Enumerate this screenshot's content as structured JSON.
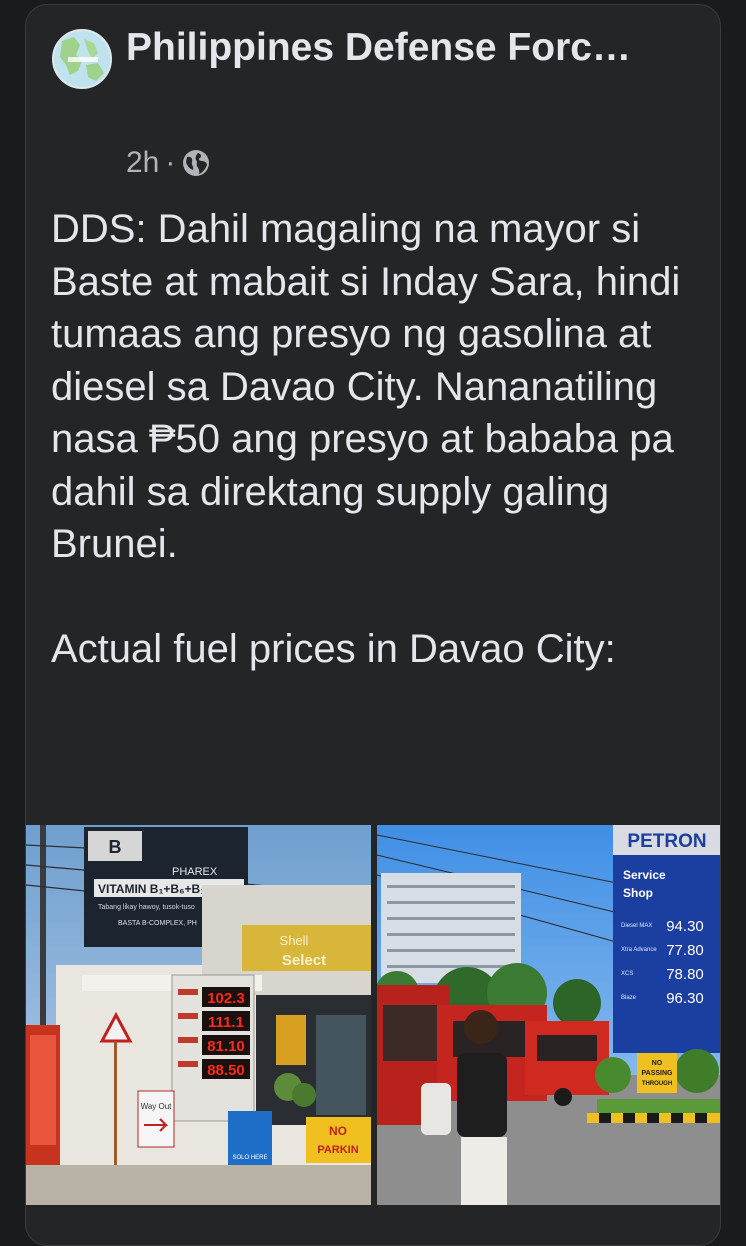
{
  "post": {
    "page_name": "Philippines Defense Forc…",
    "timestamp": "2h",
    "separator": "·",
    "audience_icon": "globe-icon",
    "text": "DDS: Dahil magaling na mayor si Baste at mabait si Inday Sara, hindi tumaas ang presyo ng gasolina at diesel sa Davao City. Nananatiling nasa ₱50 ang presyo at bababa pa dahil sa direktang supply galing Brunei.\n\nActual fuel prices in Davao City:"
  },
  "photos": {
    "left": {
      "billboard_brand": "PHAREX",
      "billboard_product": "VITAMIN B₁+B₆+B₁₂",
      "billboard_tagline": "Tabang likay hawoy, tusok-tuso",
      "billboard_footer": "BASTA B-COMPLEX, PH",
      "shell_sign_line1": "Shell",
      "shell_sign_line2": "Select",
      "prices": [
        "102.3",
        "111.1",
        "81.10",
        "88.50"
      ],
      "way_out_sign": "Way Out",
      "no_parking_line1": "NO",
      "no_parking_line2": "PARKIN",
      "solo_sign": "SOLO HERE"
    },
    "right": {
      "brand": "PETRON",
      "service_line1": "Service",
      "service_line2": "Shop",
      "fuel_names": [
        "Diesel MAX",
        "Xtra Advance",
        "XCS",
        "Blaze"
      ],
      "prices": [
        "94.30",
        "77.80",
        "78.80",
        "96.30"
      ],
      "no_passing_line1": "NO",
      "no_passing_line2": "PASSING",
      "no_passing_line3": "THROUGH"
    }
  },
  "colors": {
    "background": "#1a1b1d",
    "card": "#242527",
    "text_primary": "#e4e6eb",
    "text_secondary": "#b0b3b8",
    "petron_blue": "#1b3fa0",
    "led_red": "#ff2a1a"
  }
}
